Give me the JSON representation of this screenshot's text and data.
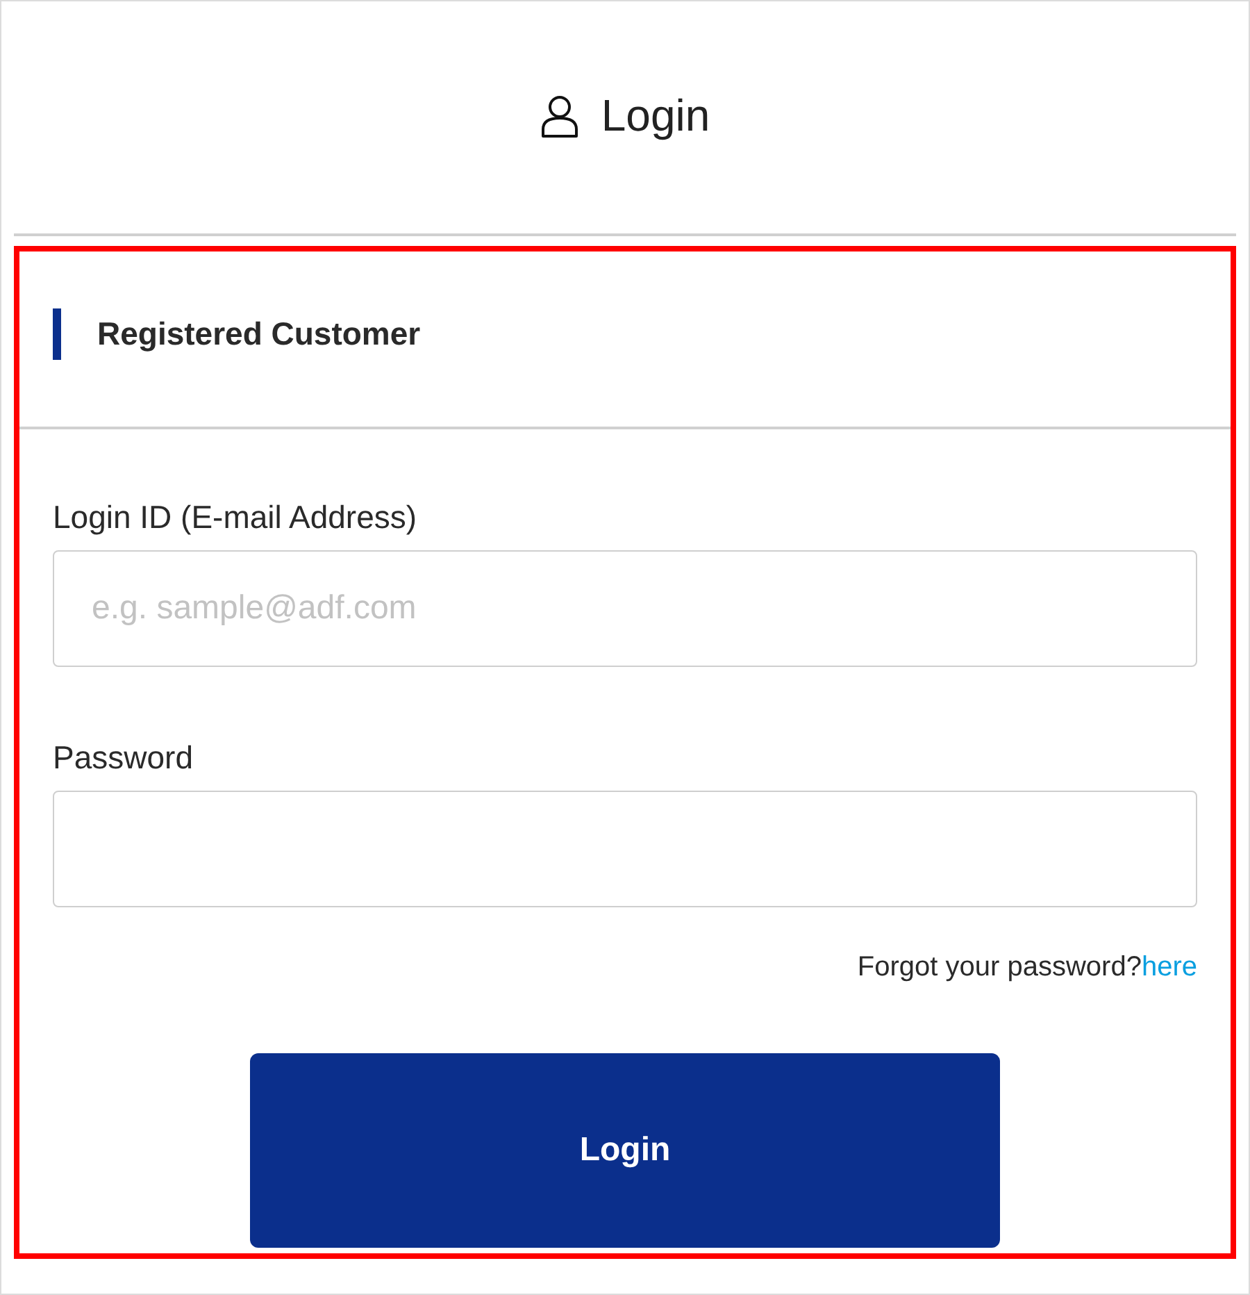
{
  "header": {
    "title": "Login"
  },
  "section": {
    "heading": "Registered Customer"
  },
  "form": {
    "fields": [
      {
        "label": "Login ID (E-mail Address)",
        "placeholder": "e.g. sample@adf.com"
      },
      {
        "label": "Password"
      }
    ],
    "forgot_text": "Forgot your password?",
    "forgot_link": "here",
    "submit": "Login"
  }
}
